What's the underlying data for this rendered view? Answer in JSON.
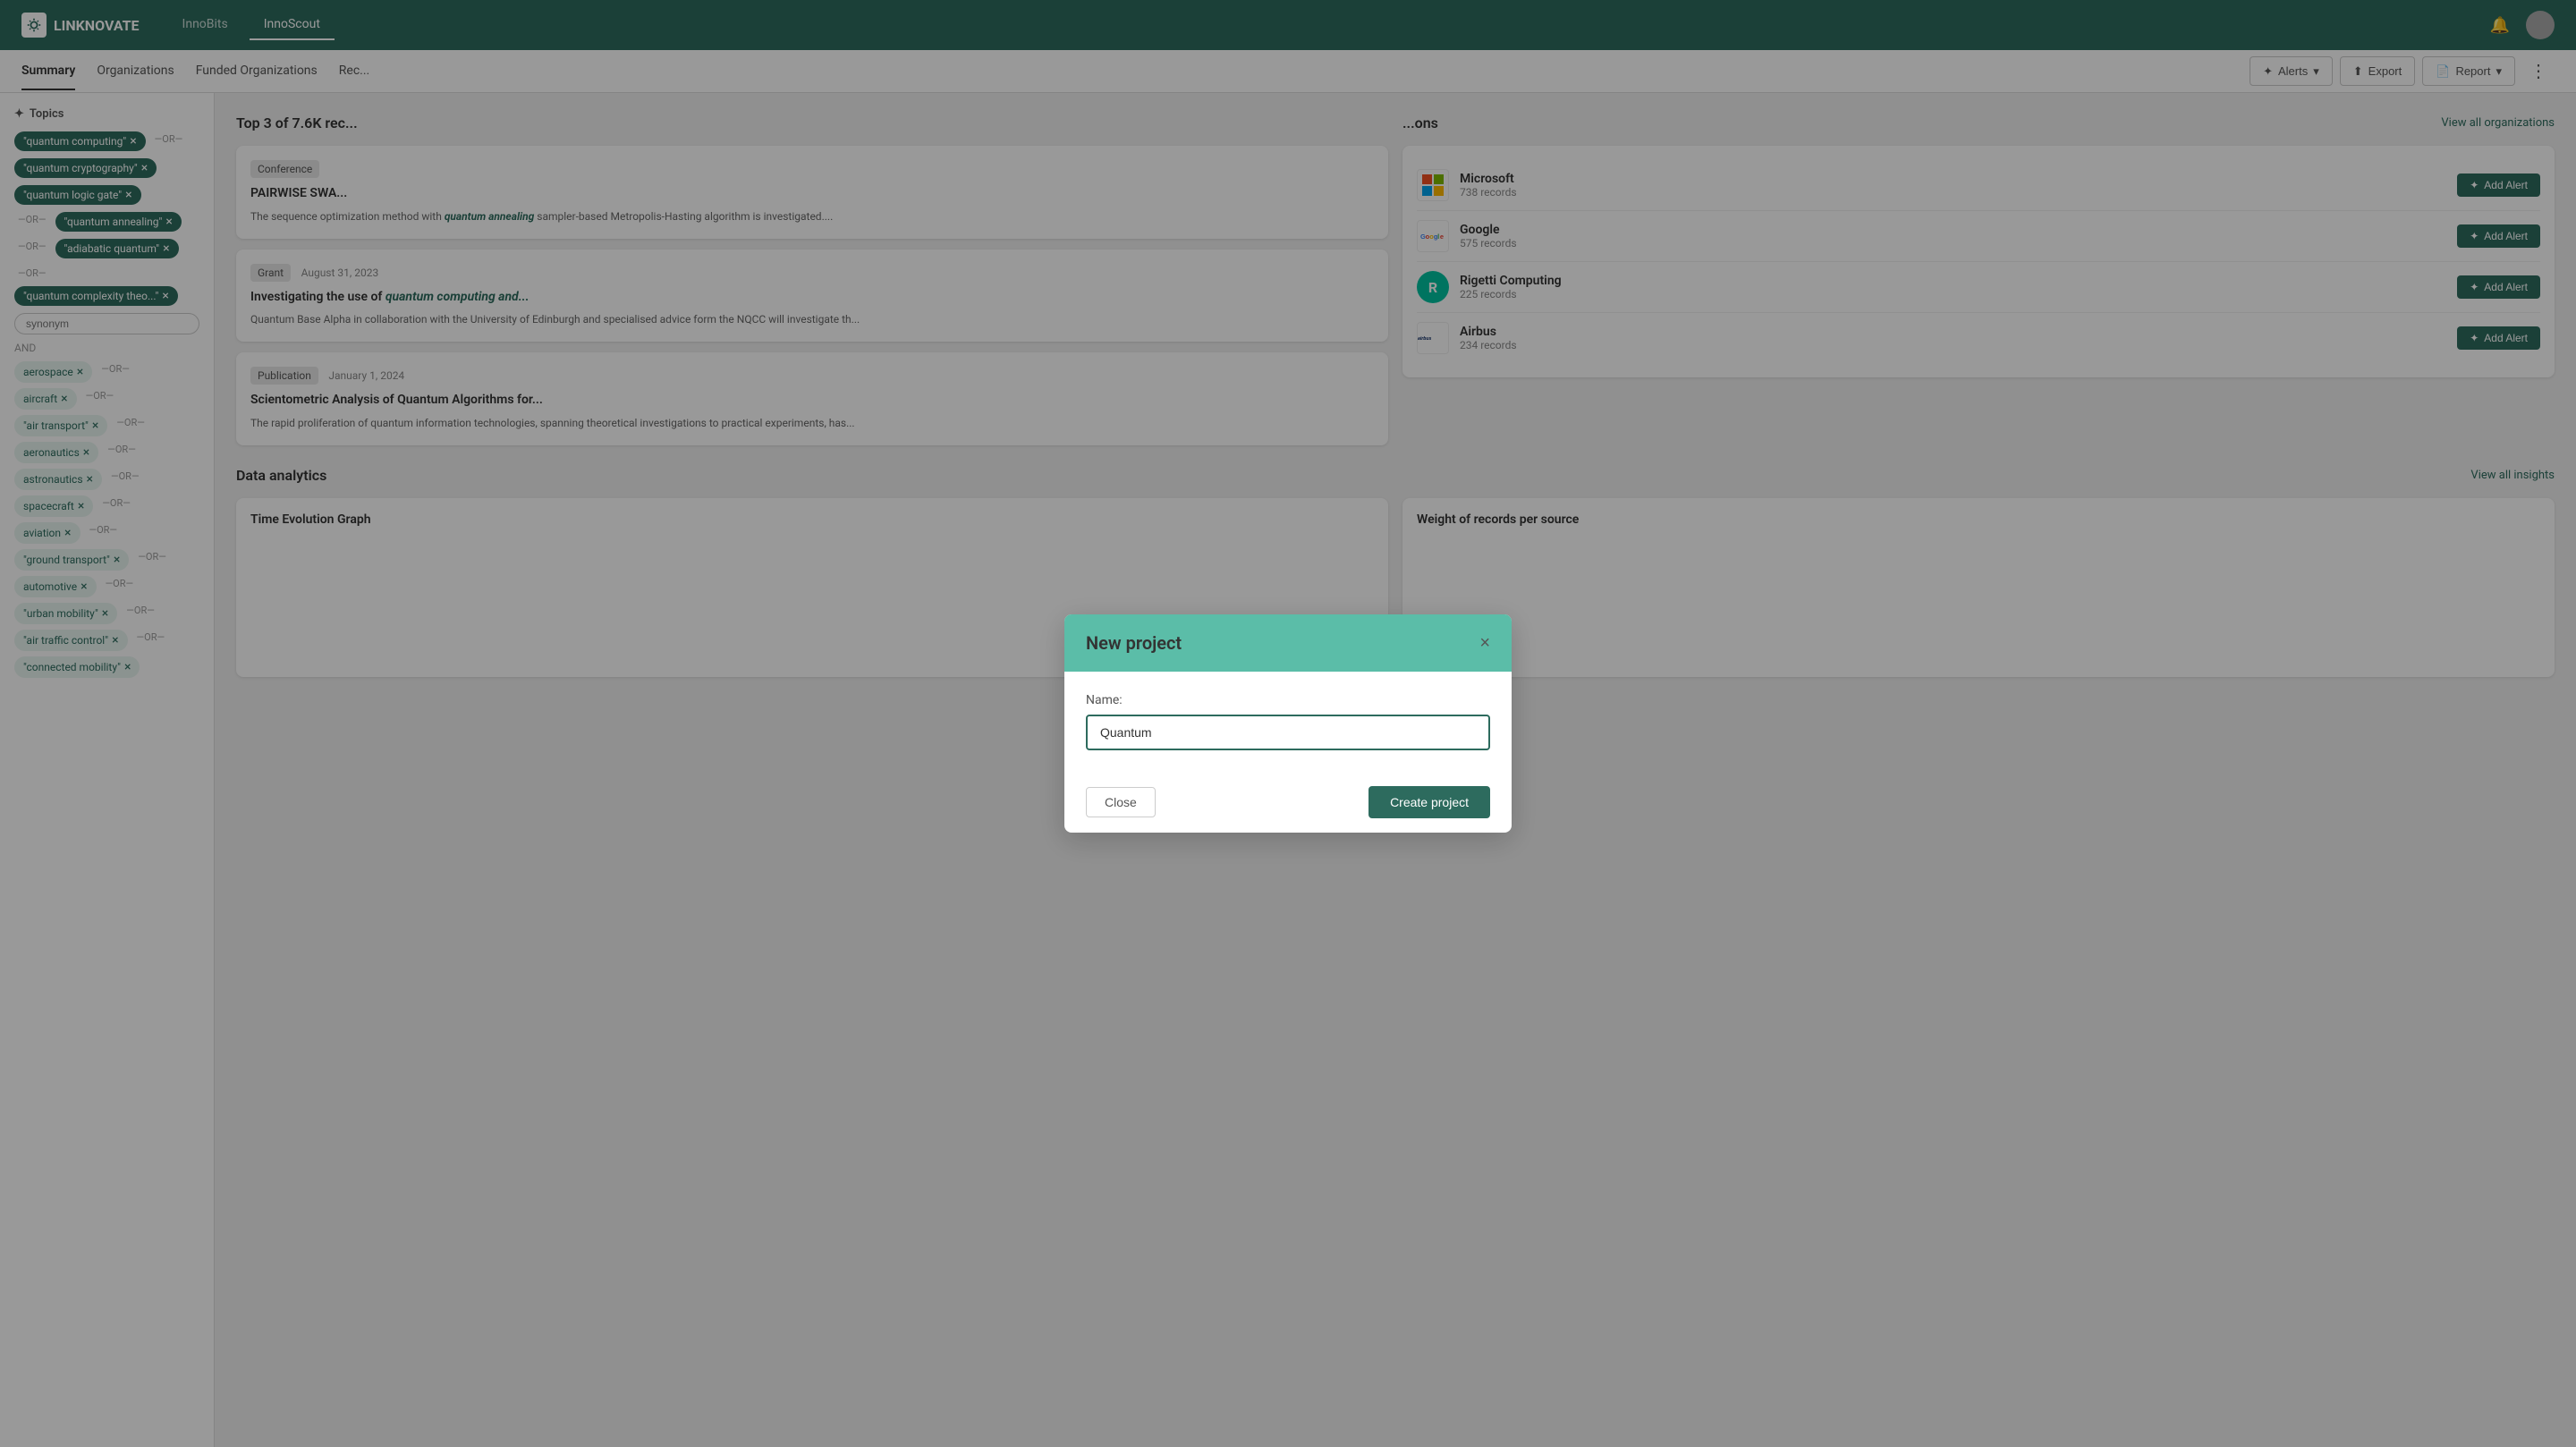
{
  "app": {
    "logo_text": "LINKNOVATE",
    "nav_tabs": [
      {
        "id": "innobits",
        "label": "InnoBits"
      },
      {
        "id": "innoscout",
        "label": "InnoScout",
        "active": true
      }
    ]
  },
  "subnav": {
    "tabs": [
      {
        "id": "summary",
        "label": "Summary",
        "active": true
      },
      {
        "id": "organizations",
        "label": "Organizations"
      },
      {
        "id": "funded",
        "label": "Funded Organizations"
      },
      {
        "id": "rec",
        "label": "Rec..."
      }
    ],
    "actions": {
      "alerts_label": "Alerts",
      "export_label": "Export",
      "report_label": "Report"
    }
  },
  "sidebar": {
    "section_title": "Topics",
    "topic_tags": [
      {
        "id": "t1",
        "label": "\"quantum computing\""
      },
      {
        "id": "t2",
        "label": "\"quantum cryptography\""
      },
      {
        "id": "t3",
        "label": "\"quantum logic gate\""
      },
      {
        "id": "t4",
        "label": "\"quantum annealing\""
      },
      {
        "id": "t5",
        "label": "\"adiabatic quantum\""
      },
      {
        "id": "t6",
        "label": "\"quantum complexity theo...\""
      }
    ],
    "synonym_placeholder": "synonym",
    "and_label": "AND",
    "keyword_tags": [
      {
        "id": "k1",
        "label": "aerospace"
      },
      {
        "id": "k2",
        "label": "aircraft"
      },
      {
        "id": "k3",
        "label": "\"air transport\""
      },
      {
        "id": "k4",
        "label": "aeronautics"
      },
      {
        "id": "k5",
        "label": "astronautics"
      },
      {
        "id": "k6",
        "label": "spacecraft"
      },
      {
        "id": "k7",
        "label": "aviation"
      },
      {
        "id": "k8",
        "label": "\"ground transport\""
      },
      {
        "id": "k9",
        "label": "automotive"
      },
      {
        "id": "k10",
        "label": "\"urban mobility\""
      },
      {
        "id": "k11",
        "label": "\"air traffic control\""
      },
      {
        "id": "k12",
        "label": "\"connected mobility\""
      }
    ]
  },
  "content": {
    "records_header": "Top 3 of 7.6K rec...",
    "records": [
      {
        "tag": "Conference",
        "date": "",
        "title_prefix": "PAIRWISE SWA...",
        "title_italic": "",
        "desc_prefix": "The sequence optimization method with",
        "desc_italic": "quantum annealing",
        "desc_suffix": "sampler-based Metropolis-Hasting algorithm is investigated...."
      },
      {
        "tag": "Grant",
        "date": "August 31, 2023",
        "title_prefix": "Investigating the use of",
        "title_italic": "quantum computing and...",
        "desc_prefix": "Quantum Base Alpha in collaboration with the University of Edinburgh and specialised advice form the NQCC will investigate th..."
      },
      {
        "tag": "Publication",
        "date": "January 1, 2024",
        "title_prefix": "Scientometric Analysis of Quantum Algorithms for...",
        "title_italic": "",
        "desc_prefix": "The rapid proliferation of quantum information technologies, spanning theoretical investigations to practical experiments, has..."
      }
    ],
    "orgs_header": "...ons",
    "view_all_orgs": "View all organizations",
    "organizations": [
      {
        "id": "microsoft",
        "name": "Microsoft",
        "records": "738 records",
        "logo_text": "Microsoft",
        "logo_color": "#f25022"
      },
      {
        "id": "google",
        "name": "Google",
        "records": "575 records",
        "logo_text": "Google",
        "logo_color": "#4285F4"
      },
      {
        "id": "rigetti",
        "name": "Rigetti Computing",
        "records": "225 records",
        "logo_text": "R",
        "logo_color": "#00c1a1"
      },
      {
        "id": "airbus",
        "name": "Airbus",
        "records": "234 records",
        "logo_text": "airbus",
        "logo_color": "#00205b"
      }
    ],
    "add_alert_label": "Add Alert",
    "analytics_title": "Data analytics",
    "view_all_insights": "View all insights",
    "analytics_cards": [
      {
        "title": "Time Evolution Graph"
      },
      {
        "title": "Weight of records per source"
      }
    ]
  },
  "modal": {
    "title": "New project",
    "name_label": "Name:",
    "name_value": "Quantum",
    "close_label": "Close",
    "create_label": "Create project"
  }
}
